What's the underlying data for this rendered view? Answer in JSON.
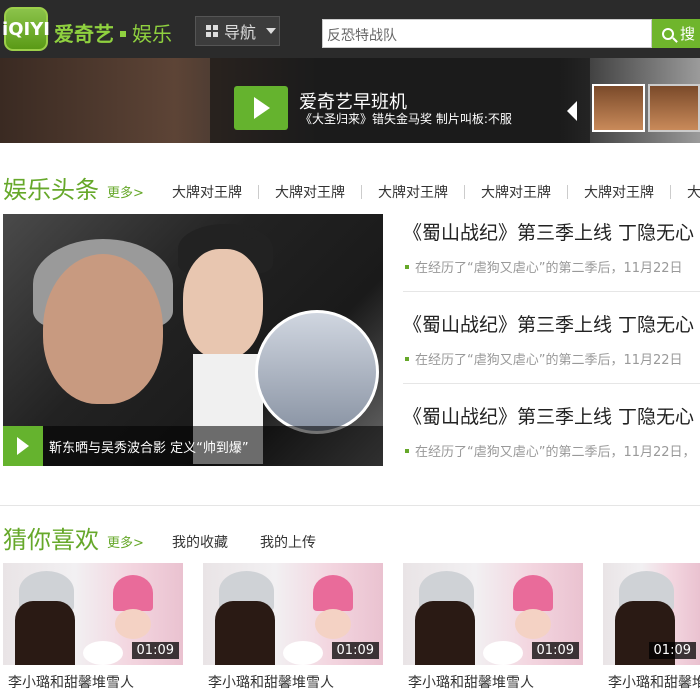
{
  "header": {
    "logo_text": "iQIYI",
    "brand": "爱奇艺",
    "channel": "娱乐",
    "nav_label": "导航",
    "search_value": "反恐特战队",
    "search_button": "搜"
  },
  "banner": {
    "title": "爱奇艺早班机",
    "subtitle": "《大圣归来》错失金马奖 制片叫板:不服"
  },
  "headlines": {
    "title": "娱乐头条",
    "more": "更多>",
    "tabs": [
      "大牌对王牌",
      "大牌对王牌",
      "大牌对王牌",
      "大牌对王牌",
      "大牌对王牌",
      "大牌"
    ],
    "hero_caption": "靳东晒与吴秀波合影 定义“帅到爆”",
    "news": [
      {
        "title": "《蜀山战纪》第三季上线 丁隐无心",
        "desc": "在经历了“虐狗又虐心”的第二季后，11月22日"
      },
      {
        "title": "《蜀山战纪》第三季上线 丁隐无心",
        "desc": "在经历了“虐狗又虐心”的第二季后，11月22日"
      },
      {
        "title": "《蜀山战纪》第三季上线 丁隐无心",
        "desc": "在经历了“虐狗又虐心”的第二季后，11月22日，"
      }
    ]
  },
  "recommend": {
    "title": "猜你喜欢",
    "more": "更多>",
    "tabs": [
      "我的收藏",
      "我的上传"
    ],
    "videos": [
      {
        "title": "李小璐和甜馨堆雪人",
        "duration": "01:09"
      },
      {
        "title": "李小璐和甜馨堆雪人",
        "duration": "01:09"
      },
      {
        "title": "李小璐和甜馨堆雪人",
        "duration": "01:09"
      },
      {
        "title": "李小璐和甜馨堆雪人",
        "duration": "01:09"
      }
    ]
  },
  "colors": {
    "accent": "#66a82a",
    "topbar": "#2b2b2b"
  }
}
